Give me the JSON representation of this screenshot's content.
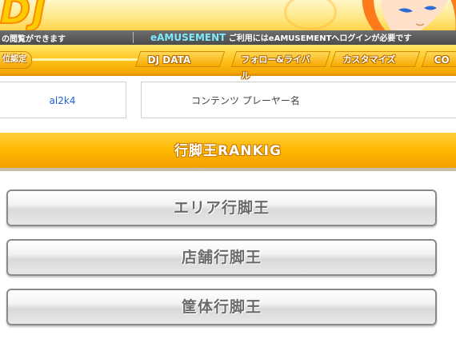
{
  "header": {
    "logo_text": "DJ",
    "notice_left": "の閲覧ができます",
    "notice_right_brand": "eAMUSEMENT",
    "notice_right_text": " ご利用にはeAMUSEMENTへログインが必要です"
  },
  "nav": {
    "items": [
      {
        "label": "位認定"
      },
      {
        "label": "DJ DATA"
      },
      {
        "label": "フォロー&ライバル"
      },
      {
        "label": "カスタマイズ"
      },
      {
        "label": "CO"
      }
    ]
  },
  "player": {
    "name": "al2k4",
    "content_label": "コンテンツ プレーヤー名"
  },
  "section": {
    "title": "行脚王RANKIG"
  },
  "buttons": [
    {
      "label": "エリア行脚王"
    },
    {
      "label": "店舗行脚王"
    },
    {
      "label": "筐体行脚王"
    }
  ],
  "colors": {
    "accent": "#ffb800",
    "link": "#1f5fd6",
    "info_bar": "#555555"
  }
}
